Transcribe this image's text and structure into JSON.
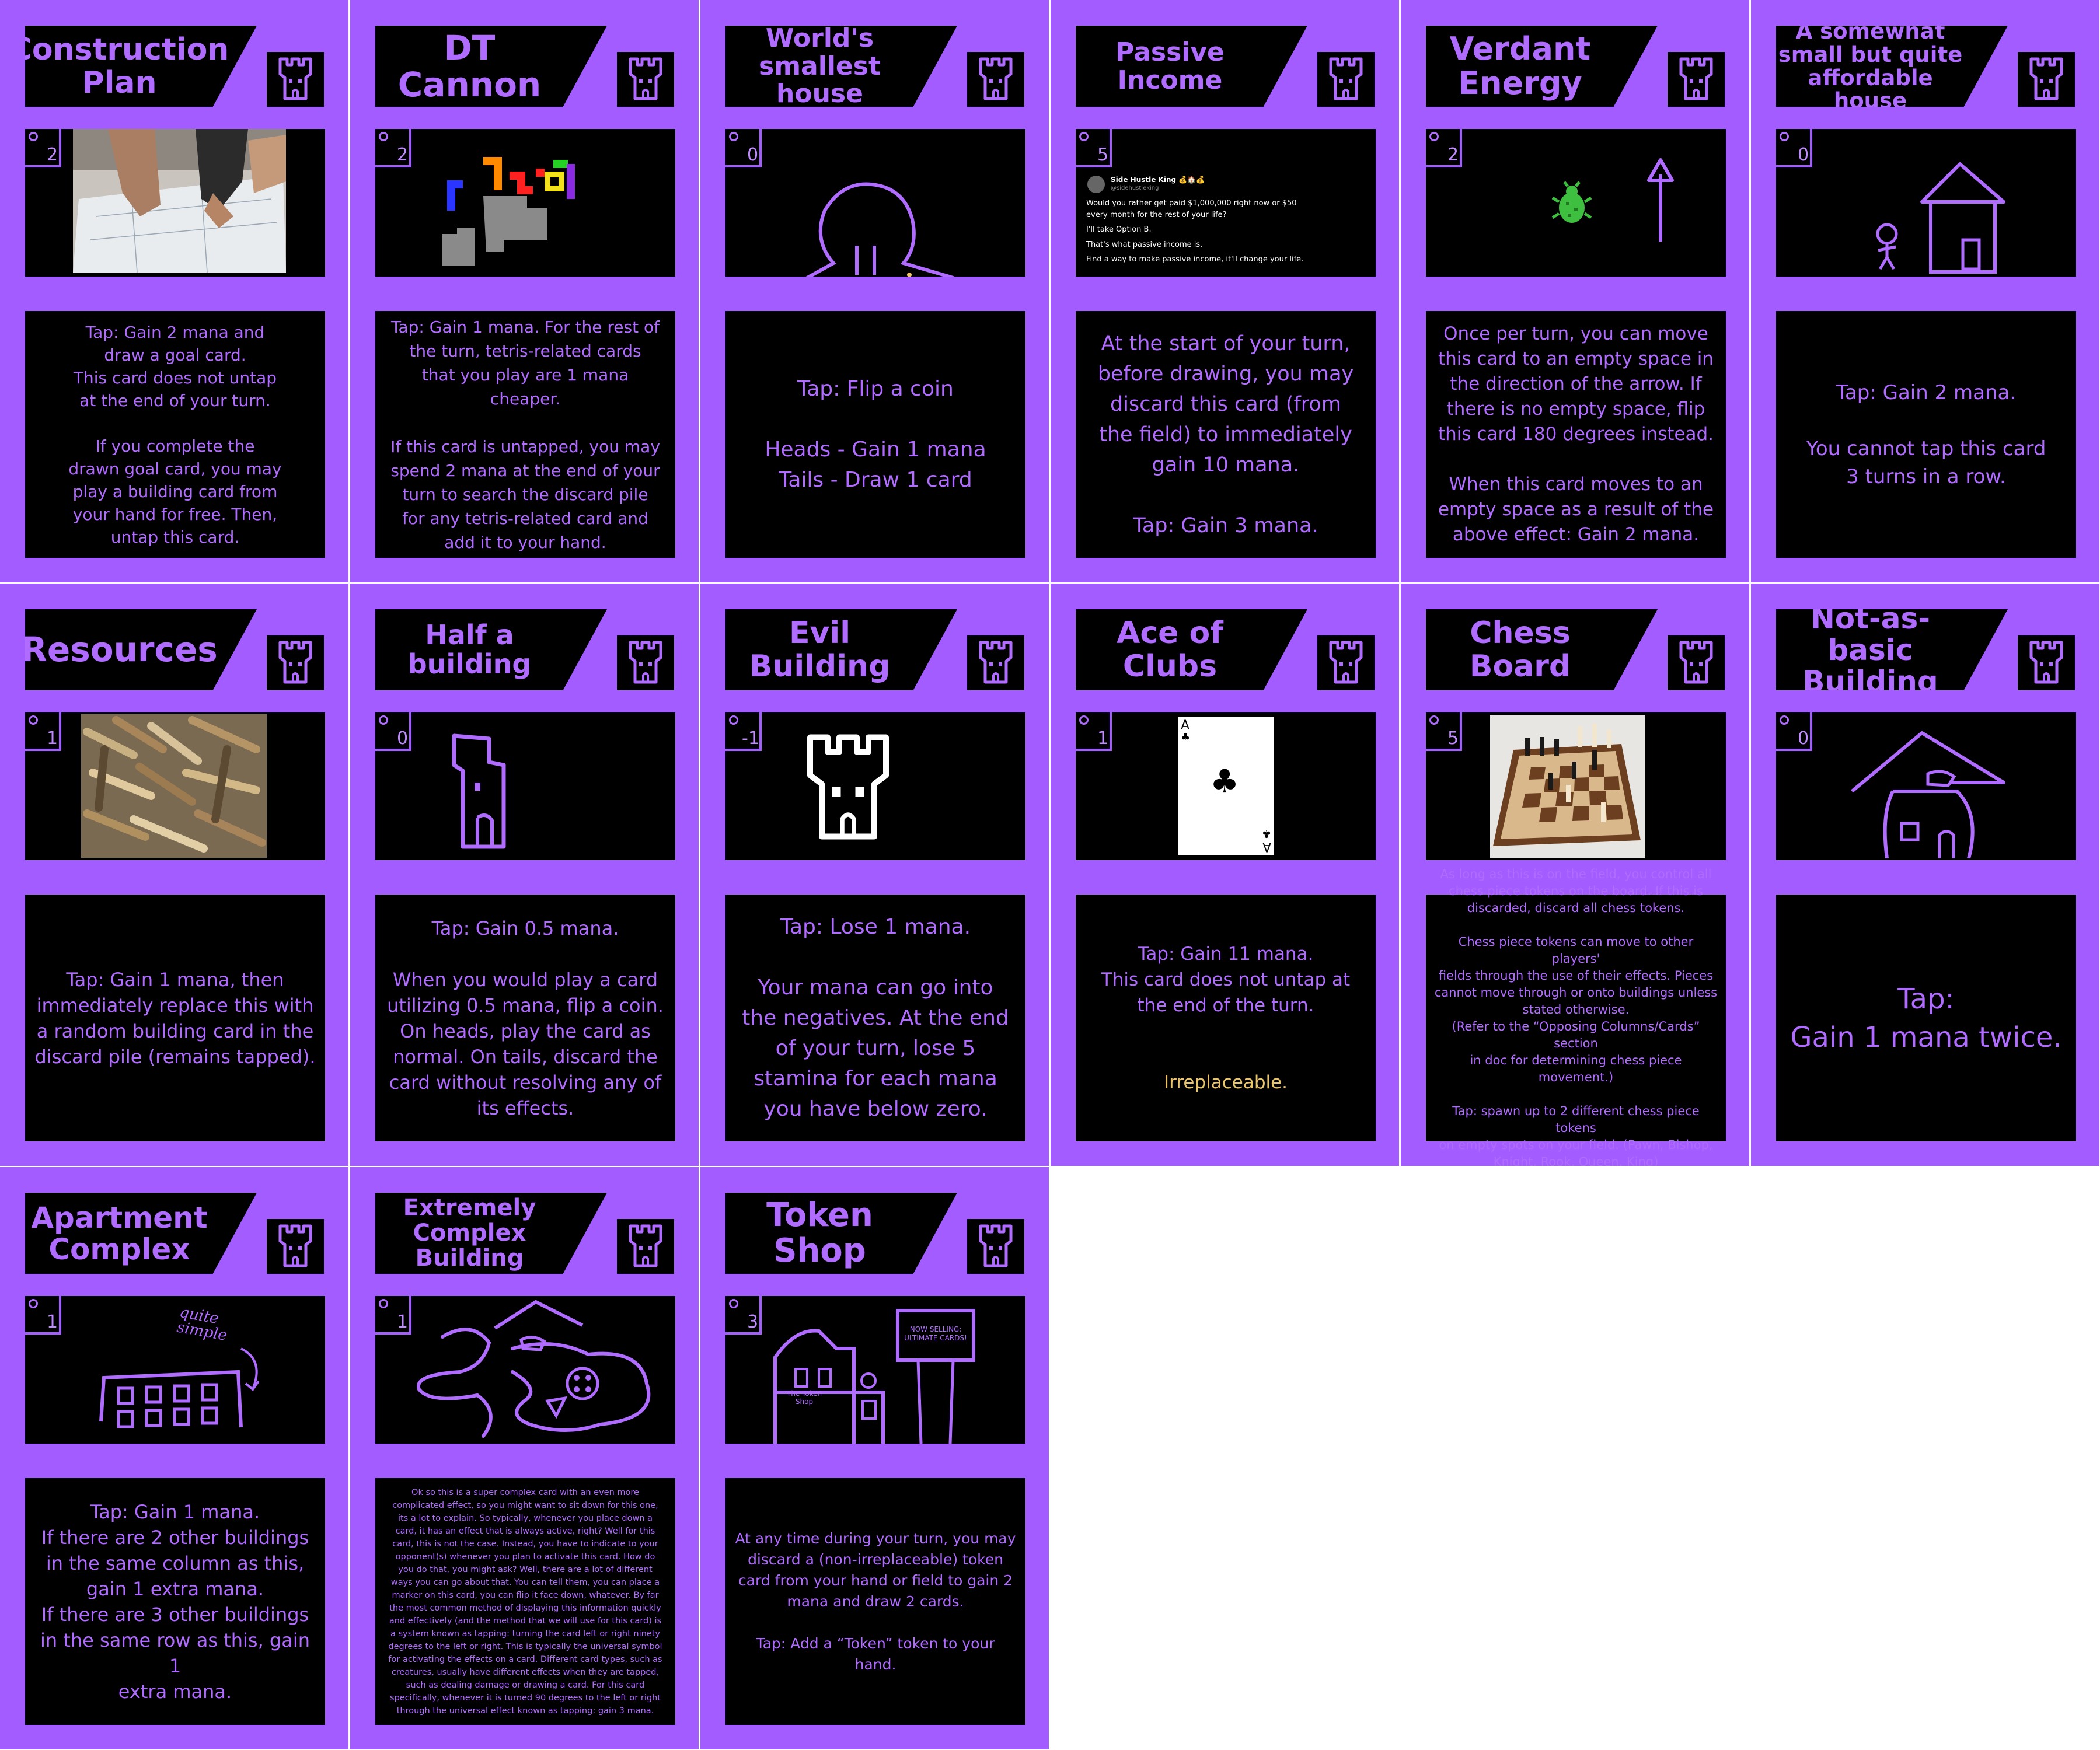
{
  "theme": {
    "card_color": "#a35cff",
    "panel_color": "#000000",
    "text_color": "#b06bff",
    "accent_gold": "#e9c46a"
  },
  "cards": [
    {
      "name": "Construction\nPlan",
      "cost": "2",
      "icon": "castle-tower-icon",
      "text": "Tap: Gain 2 mana and\ndraw a goal card.\nThis card does not untap\nat the end of your turn.\n\nIf you complete the\ndrawn goal card, you may\nplay a building card from\nyour hand for free. Then,\nuntap this card."
    },
    {
      "name": "DT Cannon",
      "cost": "2",
      "icon": "castle-tower-icon",
      "text": "Tap:  Gain 1 mana. For the rest of\nthe turn, tetris-related cards\nthat you play are 1 mana\ncheaper.\n\nIf this card is untapped, you may\nspend 2 mana at the end of your\nturn to search the discard pile\nfor any tetris-related card and\nadd it to your hand."
    },
    {
      "name": "World's smallest\nhouse",
      "cost": "0",
      "icon": "castle-tower-icon",
      "text": "Tap: Flip a coin\n\nHeads - Gain 1 mana\nTails - Draw 1 card"
    },
    {
      "name": "Passive Income",
      "cost": "5",
      "icon": "castle-tower-icon",
      "text": "At the start of your turn,\nbefore drawing, you may\ndiscard this card (from\nthe field) to immediately\ngain 10 mana.\n\nTap: Gain 3 mana.",
      "tweet": {
        "author": "Side Hustle King 💰🏠💰",
        "handle": "@sidehustleking",
        "lines": [
          "Would you rather get paid $1,000,000 right now or $50",
          "every month for the rest of your life?",
          "",
          "I'll take Option B.",
          "",
          "That's what passive income is.",
          "",
          "Find a way to make passive income, it'll change your life."
        ]
      }
    },
    {
      "name": "Verdant\nEnergy",
      "cost": "2",
      "icon": "castle-tower-icon",
      "text": "Once per turn, you can move\nthis card to an empty space in\nthe direction of the arrow. If\nthere is no empty space, flip\nthis card 180 degrees instead.\n\nWhen this card moves to an\nempty space as a result of the\nabove effect: Gain 2 mana."
    },
    {
      "name": "A somewhat\nsmall but quite\naffordable house",
      "cost": "0",
      "icon": "castle-tower-icon",
      "text": "Tap: Gain 2 mana.\n\nYou cannot tap this card\n3 turns in a row."
    },
    {
      "name": "Resources",
      "cost": "1",
      "icon": "castle-tower-icon",
      "text": "Tap: Gain 1 mana, then\nimmediately replace this with\na random building card in the\ndiscard pile (remains tapped)."
    },
    {
      "name": "Half a building",
      "cost": "0",
      "icon": "castle-tower-icon",
      "text": "Tap: Gain 0.5 mana.\n\nWhen you would play a card\nutilizing 0.5 mana, flip a coin.\nOn heads, play the card as\nnormal. On tails, discard the\ncard without resolving any of\nits effects."
    },
    {
      "name": "Evil Building",
      "cost": "-1",
      "icon": "castle-tower-icon",
      "text": "Tap: Lose 1 mana.\n\nYour mana can go into\nthe negatives. At the end\nof your turn, lose 5\nstamina for each mana\nyou have below zero."
    },
    {
      "name": "Ace of Clubs",
      "cost": "1",
      "icon": "castle-tower-icon",
      "text": "Tap: Gain 11 mana.\nThis card does not untap at\nthe end of the turn.",
      "text_extra": "Irreplaceable.",
      "playing_card": {
        "rank": "A",
        "suit": "♣"
      }
    },
    {
      "name": "Chess Board",
      "cost": "5",
      "icon": "castle-tower-icon",
      "text": "As long as this is on the field, you control all\nchess piece tokens on the board. If this is\ndiscarded, discard all chess tokens.\n\nChess piece tokens can move to other players'\nfields through the use of their effects. Pieces\ncannot move through or onto buildings unless\nstated otherwise.\n(Refer to the “Opposing Columns/Cards” section\nin doc for determining chess piece movement.)\n\nTap: spawn up to 2 different chess piece tokens\non empty spots on your field. (Pawn, Bishop,\nKnight, Rook, Queen, King)"
    },
    {
      "name": "Not-as-basic\nBuilding",
      "cost": "0",
      "icon": "castle-tower-icon",
      "text": "Tap:\nGain 1 mana twice."
    },
    {
      "name": "Apartment\nComplex",
      "cost": "1",
      "icon": "castle-tower-icon",
      "art_note": "quite\nsimple",
      "text": "Tap: Gain 1 mana.\nIf there are 2 other buildings\nin the same column as this,\ngain 1 extra mana.\nIf there are 3 other buildings\nin the same row as this, gain 1\nextra mana."
    },
    {
      "name": "Extremely\nComplex Building",
      "cost": "1",
      "icon": "castle-tower-icon",
      "text": "Ok so this is a super complex card with an even more complicated effect, so you might want to sit down for this one, its a lot to explain. So typically, whenever you place down a card, it has an effect that is always active, right? Well for this card, this is not the case. Instead, you have to indicate to your opponent(s) whenever you plan to activate this card. How do you do that, you might ask? Well, there are a lot of different ways you can go about that. You can tell them, you can place a marker on this card, you can flip it face down, whatever. By far the most common method of displaying this information quickly and effectively (and the method that we will use for this card) is a system known as tapping: turning the card left or right ninety degrees to the left or right. This is typically the universal symbol for activating the effects on a card. Different card types, such as creatures, usually have different effects when they are tapped, such as dealing damage or drawing a card. For this card specifically, whenever it is turned 90 degrees to the left or right through the universal effect known as tapping: gain 3 mana."
    },
    {
      "name": "Token Shop",
      "cost": "3",
      "icon": "castle-tower-icon",
      "sign_text": "NOW SELLING:\nULTIMATE CARDS!",
      "shop_label": "The Token Shop",
      "text": "At any time during your turn, you may\ndiscard a (non-irreplaceable) token\ncard from your hand or field to gain 2\nmana and draw 2 cards.\n\nTap: Add a “Token” token to your hand."
    }
  ]
}
